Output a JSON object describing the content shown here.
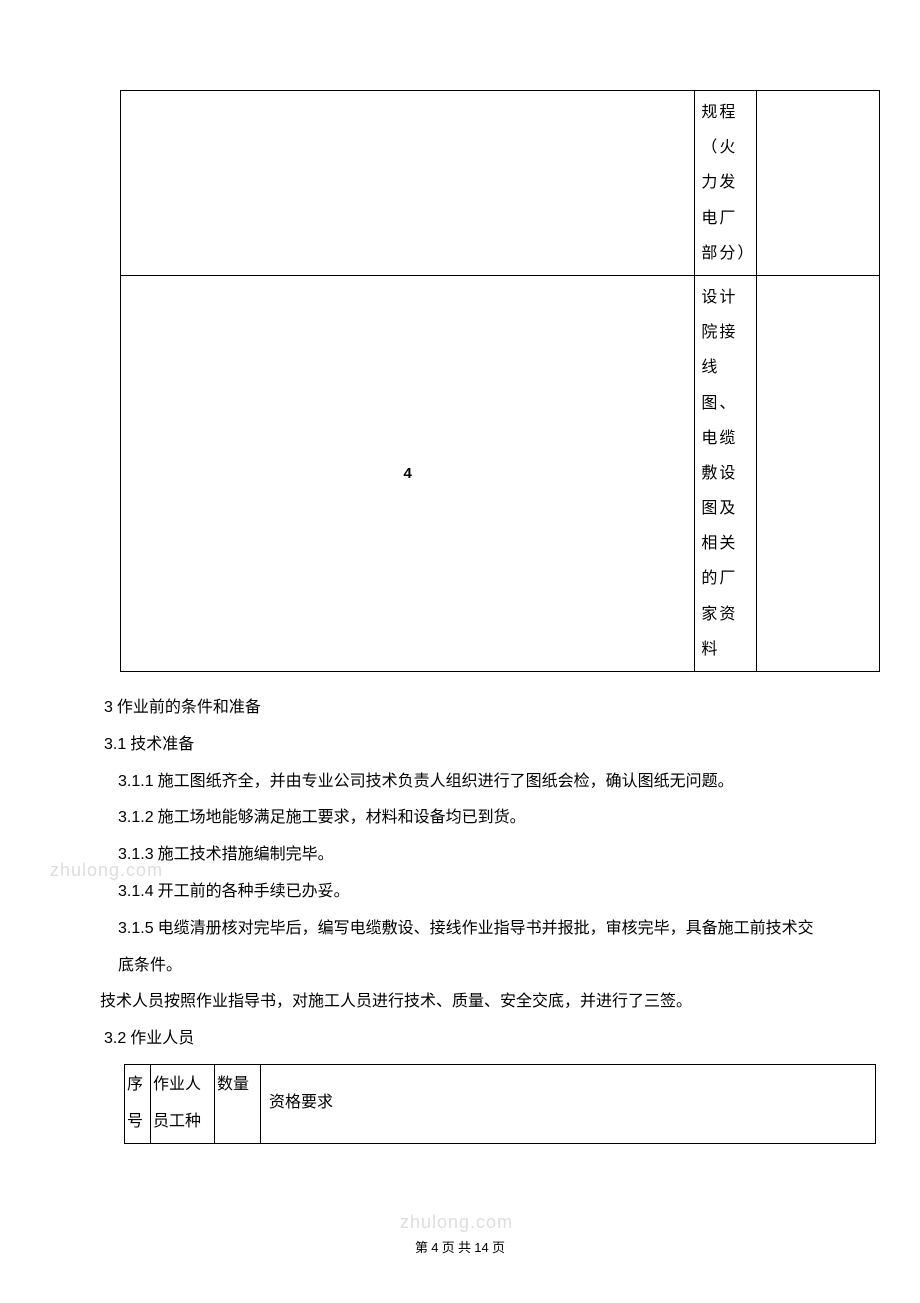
{
  "table1": {
    "row1": {
      "c1": "",
      "c2": "规程（火力发电厂部分）",
      "c3": ""
    },
    "row2": {
      "c1": "4",
      "c2": "设计院接线图、电缆敷设图及相关的厂家资料",
      "c3": ""
    }
  },
  "section3": {
    "title_num": "3",
    "title_text": " 作业前的条件和准备",
    "s31_num": "3.1",
    "s31_text": "  技术准备",
    "p311_num": "3.1.1",
    "p311_text": " 施工图纸齐全，并由专业公司技术负责人组织进行了图纸会检，确认图纸无问题。",
    "p312_num": "3.1.2",
    "p312_text": " 施工场地能够满足施工要求，材料和设备均已到货。",
    "p313_num": "3.1.3",
    "p313_text": " 施工技术措施编制完毕。",
    "p314_num": "3.1.4",
    "p314_text": " 开工前的各种手续已办妥。",
    "p315_num": "3.1.5",
    "p315_text": " 电缆清册核对完毕后，编写电缆敷设、接线作业指导书并报批，审核完毕，具备施工前技术交底条件。",
    "p_extra": "技术人员按照作业指导书，对施工人员进行技术、质量、安全交底，并进行了三签。",
    "s32_num": "3.2",
    "s32_text": "  作业人员"
  },
  "table2": {
    "h1": "序号",
    "h2": "作业人员工种",
    "h3": "数量",
    "h4": "资格要求"
  },
  "watermark": "zhulong.com",
  "footer": {
    "prefix": "第 ",
    "page": "4",
    "mid": " 页    共 ",
    "total": "14",
    "suffix": " 页"
  }
}
